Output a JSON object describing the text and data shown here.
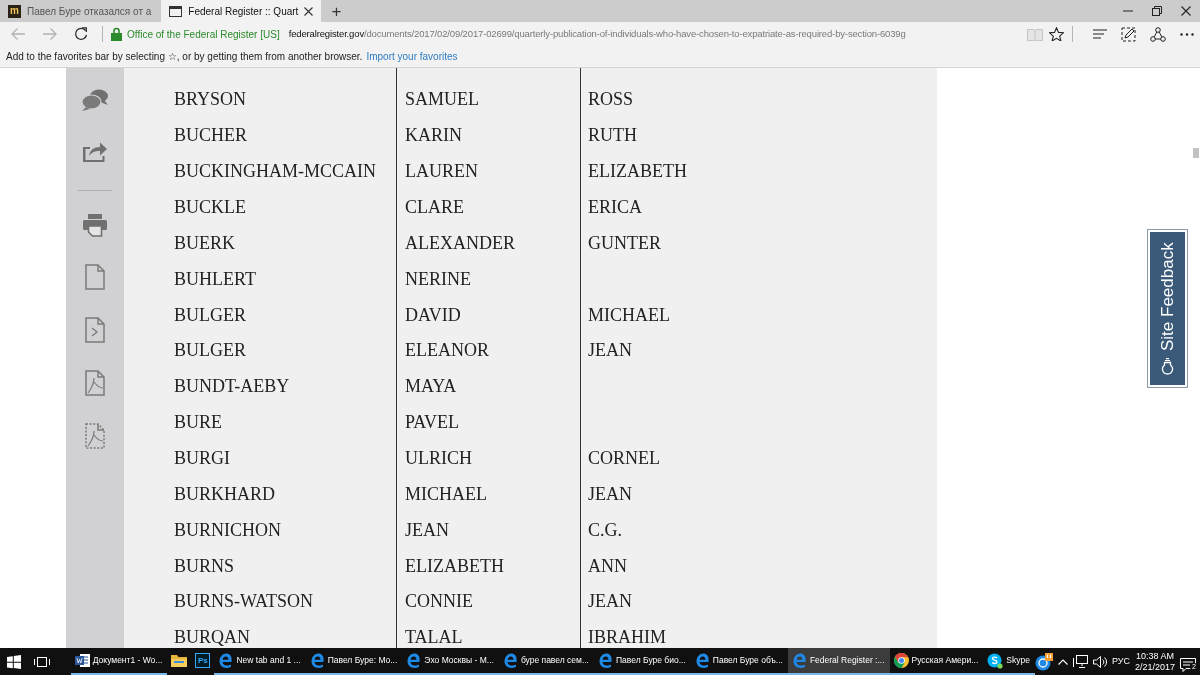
{
  "browser": {
    "tabs": [
      {
        "title": "Павел Буре отказался от а",
        "favicon_text": "m",
        "selected": false
      },
      {
        "title": "Federal Register :: Quart",
        "selected": true
      }
    ],
    "new_tab": "+",
    "nav_buttons": [
      {
        "kind": "back",
        "disabled": true
      },
      {
        "kind": "forward",
        "disabled": true
      },
      {
        "kind": "refresh",
        "disabled": false
      }
    ],
    "site_identity": "Office of the Federal Register [US]",
    "url_domain": "federalregister.gov",
    "url_path": "/documents/2017/02/09/2017-02699/quarterly-publication-of-individuals-who-have-chosen-to-expatriate-as-required-by-section-6039g"
  },
  "favorites_bar": {
    "message": "Add to the favorites bar by selecting ☆, or by getting them from another browser.",
    "link": "Import your favorites"
  },
  "table": {
    "rows": [
      {
        "column_1": "BRYSON",
        "column_2": "SAMUEL",
        "column_3": "ROSS"
      },
      {
        "column_1": "BUCHER",
        "column_2": "KARIN",
        "column_3": "RUTH"
      },
      {
        "column_1": "BUCKINGHAM-MCCAIN",
        "column_2": "LAUREN",
        "column_3": "ELIZABETH"
      },
      {
        "column_1": "BUCKLE",
        "column_2": "CLARE",
        "column_3": "ERICA"
      },
      {
        "column_1": "BUERK",
        "column_2": "ALEXANDER",
        "column_3": "GUNTER"
      },
      {
        "column_1": "BUHLERT",
        "column_2": "NERINE"
      },
      {
        "column_1": "BULGER",
        "column_2": "DAVID",
        "column_3": "MICHAEL"
      },
      {
        "column_1": "BULGER",
        "column_2": "ELEANOR",
        "column_3": "JEAN"
      },
      {
        "column_1": "BUNDT-AEBY",
        "column_2": "MAYA"
      },
      {
        "column_1": "BURE",
        "column_2": "PAVEL"
      },
      {
        "column_1": "BURGI",
        "column_2": "ULRICH",
        "column_3": "CORNEL"
      },
      {
        "column_1": "BURKHARD",
        "column_2": "MICHAEL",
        "column_3": "JEAN"
      },
      {
        "column_1": "BURNICHON",
        "column_2": "JEAN",
        "column_3": "C.G."
      },
      {
        "column_1": "BURNS",
        "column_2": "ELIZABETH",
        "column_3": "ANN"
      },
      {
        "column_1": "BURNS-WATSON",
        "column_2": "CONNIE",
        "column_3": "JEAN"
      },
      {
        "column_1": "BURQAN",
        "column_2": "TALAL",
        "column_3": "IBRAHIM"
      }
    ]
  },
  "feedback_tab": {
    "label": "Site Feedback"
  },
  "taskbar": {
    "items": [
      {
        "kind": "word",
        "label": "Документ1 - Wo...",
        "running": true,
        "selected": false
      },
      {
        "kind": "explorer",
        "running": false,
        "selected": false
      },
      {
        "kind": "photoshop",
        "logo_text": "Ps",
        "running": false,
        "selected": false
      },
      {
        "kind": "edge",
        "label": "New tab and 1 ...",
        "running": true,
        "selected": false
      },
      {
        "kind": "edge",
        "label": "Павел Буре: Mo...",
        "running": true,
        "selected": false
      },
      {
        "kind": "edge",
        "label": "Эхо Москвы - M...",
        "running": true,
        "selected": false
      },
      {
        "kind": "edge",
        "label": "буре павел сем...",
        "running": true,
        "selected": false
      },
      {
        "kind": "edge",
        "label": "Павел Буре био...",
        "running": true,
        "selected": false
      },
      {
        "kind": "edge",
        "label": "Павел Буре объ...",
        "running": true,
        "selected": false
      },
      {
        "kind": "edge",
        "label": "Federal Register :...",
        "running": true,
        "selected": true
      },
      {
        "kind": "chrome",
        "label": "Русская Амери...",
        "running": true,
        "selected": false
      },
      {
        "kind": "skype",
        "label": "Skype",
        "running": true,
        "selected": false
      }
    ],
    "language": "РУС",
    "time": "10:38 AM",
    "date": "2/21/2017",
    "notification_count": "2"
  }
}
